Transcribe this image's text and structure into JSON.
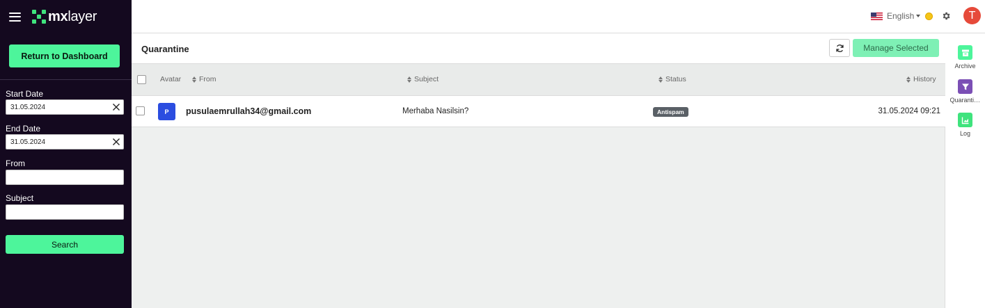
{
  "brand": {
    "name_bold": "mx",
    "name_rest": "layer",
    "accent": "#4df59b"
  },
  "sidebar": {
    "dashboard_button": "Return to Dashboard",
    "start_date": {
      "label": "Start Date",
      "value": "31.05.2024"
    },
    "end_date": {
      "label": "End Date",
      "value": "31.05.2024"
    },
    "from": {
      "label": "From",
      "value": ""
    },
    "subject": {
      "label": "Subject",
      "value": ""
    },
    "search_button": "Search"
  },
  "header": {
    "language": "English",
    "avatar_initial": "T"
  },
  "main": {
    "title": "Quarantine",
    "manage_button": "Manage Selected",
    "columns": {
      "avatar": "Avatar",
      "from": "From",
      "subject": "Subject",
      "status": "Status",
      "history": "History"
    },
    "rows": [
      {
        "avatar": "P",
        "from": "pusulaemrullah34@gmail.com",
        "subject": "Merhaba Nasilsin?",
        "status": "Antispam",
        "history": "31.05.2024 09:21"
      }
    ]
  },
  "rail": {
    "items": [
      {
        "label": "Archive",
        "color": "#4df59b",
        "icon": "archive-icon"
      },
      {
        "label": "Quarantine",
        "color": "#7b4fb5",
        "icon": "filter-icon"
      },
      {
        "label": "Log",
        "color": "#3fe37d",
        "icon": "chart-icon"
      }
    ]
  }
}
